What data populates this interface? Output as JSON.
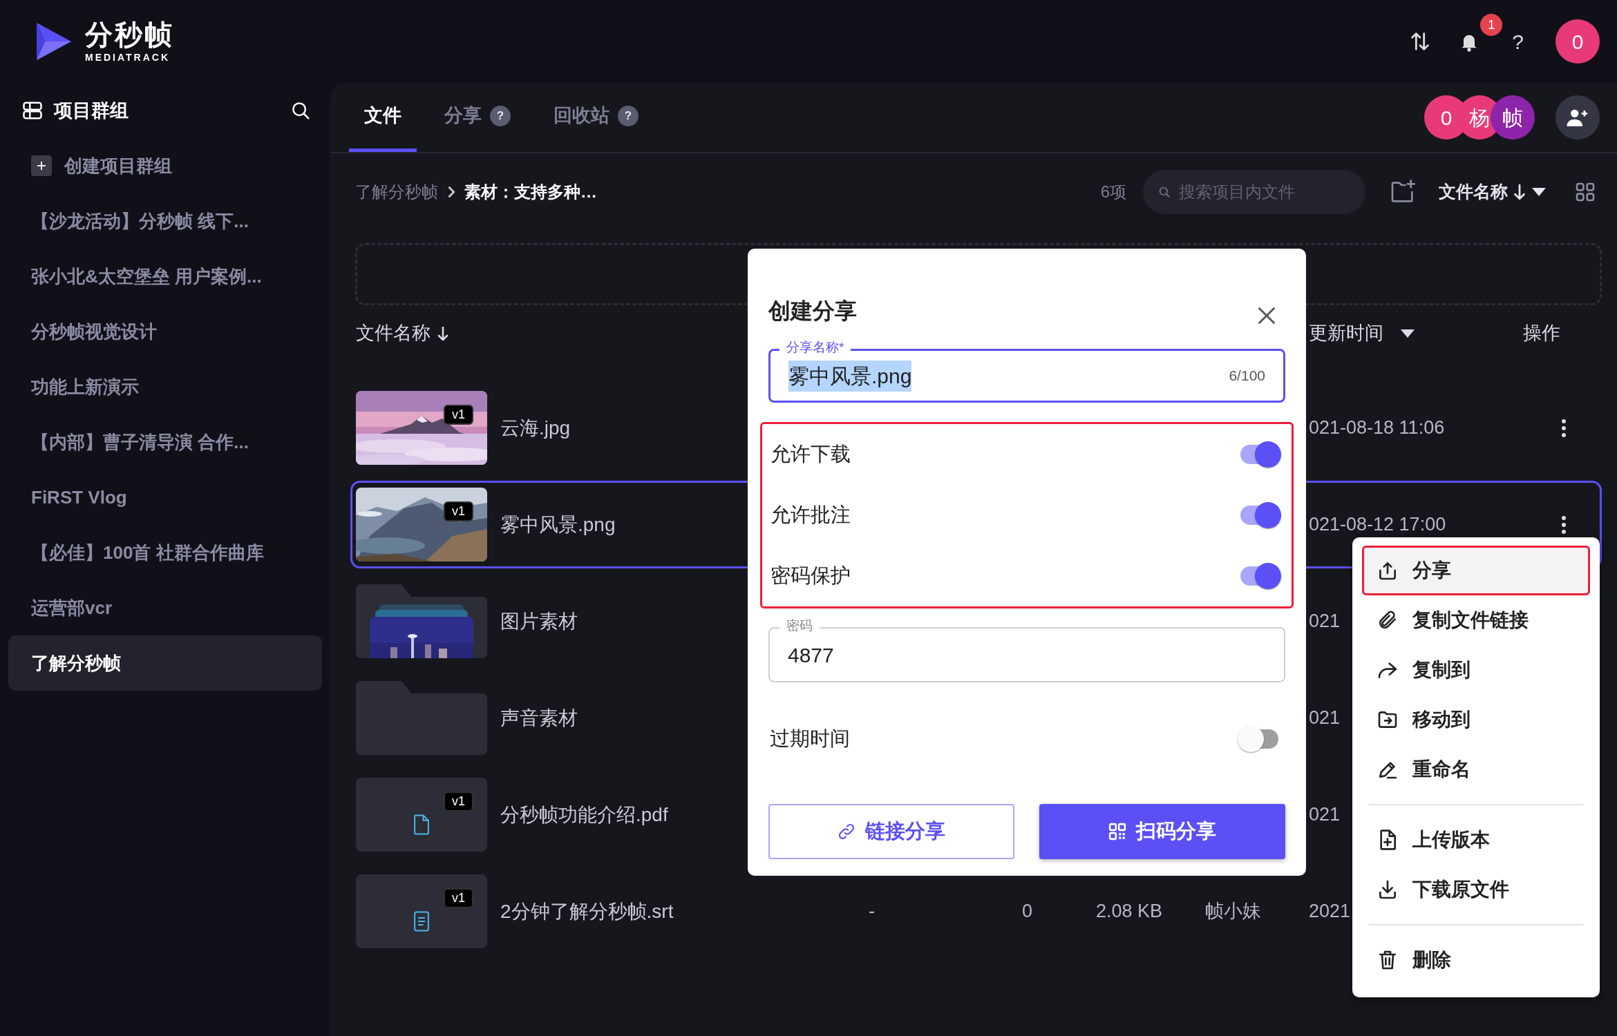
{
  "app": {
    "logo_title": "分秒帧",
    "logo_subtitle": "MEDIATRACK"
  },
  "top_bar": {
    "notification_count": "1",
    "help": "?",
    "avatar": "0"
  },
  "sidebar": {
    "title": "项目群组",
    "create_label": "创建项目群组",
    "items": [
      {
        "label": "【沙龙活动】分秒帧 线下...",
        "selected": false
      },
      {
        "label": "张小北&太空堡垒 用户案例...",
        "selected": false
      },
      {
        "label": "分秒帧视觉设计",
        "selected": false
      },
      {
        "label": "功能上新演示",
        "selected": false
      },
      {
        "label": "【内部】曹子清导演 合作...",
        "selected": false
      },
      {
        "label": "FiRST Vlog",
        "selected": false
      },
      {
        "label": "【必佳】100首 社群合作曲库",
        "selected": false
      },
      {
        "label": "运营部vcr",
        "selected": false
      },
      {
        "label": "了解分秒帧",
        "selected": true
      }
    ]
  },
  "tabs": [
    {
      "label": "文件",
      "selected": true
    },
    {
      "label": "分享",
      "help": "?",
      "selected": false
    },
    {
      "label": "回收站",
      "help": "?",
      "selected": false
    }
  ],
  "members": [
    {
      "initial": "0",
      "color": "#e83a78"
    },
    {
      "initial": "杨",
      "color": "#e83a78"
    },
    {
      "initial": "帧",
      "color": "#8e24aa"
    }
  ],
  "breadcrumb": [
    {
      "label": "了解分秒帧"
    },
    {
      "label": "素材：支持多种…"
    }
  ],
  "toolbar": {
    "count": "6项",
    "search_placeholder": "搜索项目内文件",
    "sort_label": "文件名称"
  },
  "table": {
    "columns": [
      {
        "label": "文件名称"
      },
      {
        "label": "更新时间"
      },
      {
        "label": "操作"
      }
    ],
    "rows": [
      {
        "name": "云海.jpg",
        "version": "v1",
        "updated": "021-08-18 11:06",
        "menu_button": true,
        "selected": false
      },
      {
        "name": "雾中风景.png",
        "version": "v1",
        "updated": "021-08-12 17:00",
        "menu_button": true,
        "selected": true
      },
      {
        "kind": "album",
        "name": "图片素材",
        "updated": "021",
        "menu_button": false,
        "selected": false
      },
      {
        "kind": "folder",
        "name": "声音素材",
        "updated": "021",
        "menu_button": false,
        "selected": false
      },
      {
        "kind": "pdf",
        "name": "分秒帧功能介绍.pdf",
        "version": "v1",
        "updated": "021",
        "menu_button": false,
        "selected": false
      },
      {
        "kind": "text",
        "name": "2分钟了解分秒帧.srt",
        "version": "v1",
        "column_3": "-",
        "column_4": "0",
        "column_5": "2.08 KB",
        "column_6": "帧小妹",
        "updated": "2021",
        "menu_button": false,
        "selected": false
      }
    ]
  },
  "modal": {
    "title": "创建分享",
    "name_field": {
      "label": "分享名称*",
      "value": "雾中风景.png",
      "selected": true,
      "counter": "6/100"
    },
    "options_highlighted": true,
    "options": [
      {
        "label": "允许下载",
        "on": true
      },
      {
        "label": "允许批注",
        "on": true
      },
      {
        "label": "密码保护",
        "on": true
      }
    ],
    "password_field": {
      "label": "密码",
      "value": "4877"
    },
    "expiry": {
      "label": "过期时间",
      "on": false
    },
    "buttons": [
      {
        "label": "链接分享",
        "kind": "outline"
      },
      {
        "label": "扫码分享",
        "kind": "primary"
      }
    ]
  },
  "context_menu": {
    "groups": [
      [
        {
          "label": "分享",
          "highlighted": true
        },
        {
          "label": "复制文件链接",
          "highlighted": false
        },
        {
          "label": "复制到",
          "highlighted": false
        },
        {
          "label": "移动到",
          "highlighted": false
        },
        {
          "label": "重命名",
          "highlighted": false
        }
      ],
      [
        {
          "label": "上传版本",
          "highlighted": false
        },
        {
          "label": "下载原文件",
          "highlighted": false
        }
      ],
      [
        {
          "label": "删除",
          "highlighted": false
        }
      ]
    ]
  }
}
